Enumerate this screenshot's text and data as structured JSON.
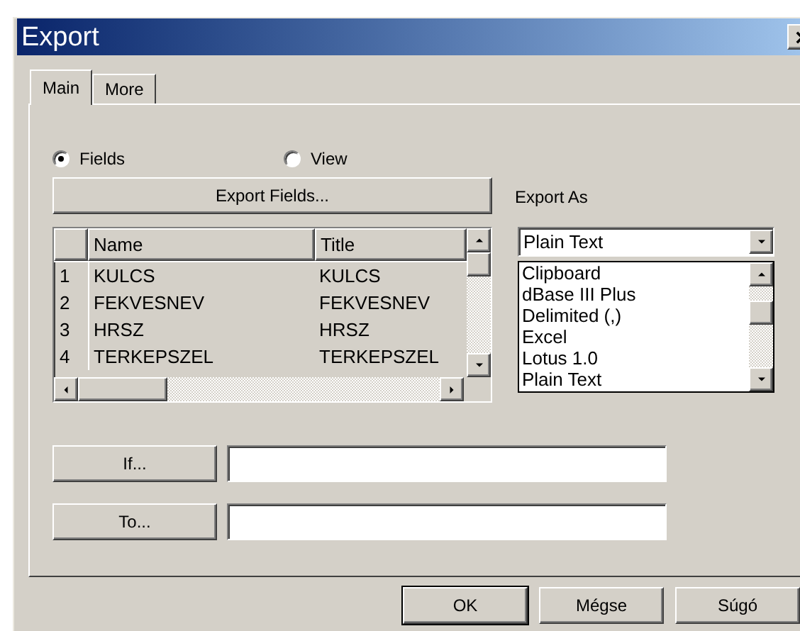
{
  "window": {
    "title": "Export"
  },
  "tabs": [
    {
      "label": "Main",
      "selected": true
    },
    {
      "label": "More",
      "selected": false
    }
  ],
  "source": [
    {
      "label": "Fields",
      "selected": true
    },
    {
      "label": "View",
      "selected": false
    }
  ],
  "export_fields_button": "Export Fields...",
  "grid": {
    "columns": [
      "Name",
      "Title"
    ],
    "rows": [
      {
        "index": "1",
        "name": "KULCS",
        "title": "KULCS"
      },
      {
        "index": "2",
        "name": "FEKVESNEV",
        "title": "FEKVESNEV"
      },
      {
        "index": "3",
        "name": "HRSZ",
        "title": "HRSZ"
      },
      {
        "index": "4",
        "name": "TERKEPSZEL",
        "title": "TERKEPSZEL"
      }
    ]
  },
  "export_as": {
    "label": "Export As",
    "value": "Plain Text",
    "options": [
      "Clipboard",
      "dBase III Plus",
      "Delimited (,)",
      "Excel",
      "Lotus 1.0",
      "Plain Text"
    ]
  },
  "conditions": [
    {
      "button": "If..."
    },
    {
      "button": "To..."
    }
  ],
  "buttons": [
    {
      "label": "OK",
      "default": true
    },
    {
      "label": "Mégse",
      "default": false
    },
    {
      "label": "Súgó",
      "default": false
    }
  ]
}
